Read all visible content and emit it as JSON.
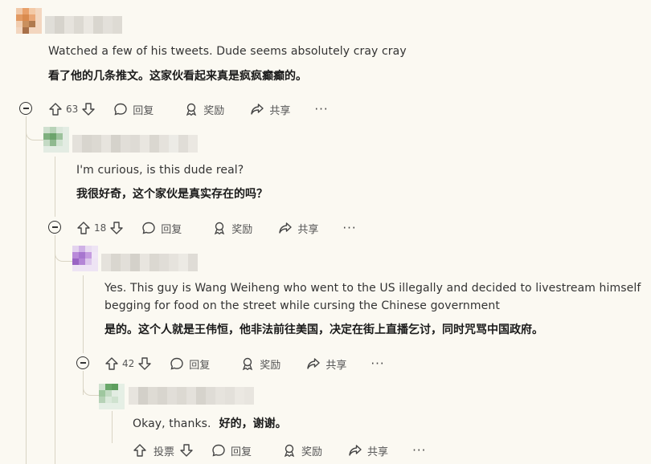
{
  "comments": [
    {
      "text_en": "Watched a few of his tweets. Dude seems absolutely cray cray",
      "text_zh": "看了他的几条推文。这家伙看起来真是疯疯癫癫的。",
      "score": "63",
      "reply_label": "回复",
      "award_label": "奖励",
      "share_label": "共享",
      "more_label": "···"
    },
    {
      "text_en": "I'm curious, is this dude real?",
      "text_zh": "我很好奇，这个家伙是真实存在的吗？",
      "score": "18",
      "reply_label": "回复",
      "award_label": "奖励",
      "share_label": "共享",
      "more_label": "···"
    },
    {
      "text_en_line1": "Yes. This guy is Wang Weiheng who went to the US illegally and decided to livestream himself",
      "text_en_line2": "begging for food on the street while cursing the Chinese government",
      "text_zh": "是的。这个人就是王伟恒，他非法前往美国，决定在街上直播乞讨，同时咒骂中国政府。",
      "score": "42",
      "reply_label": "回复",
      "award_label": "奖励",
      "share_label": "共享",
      "more_label": "···"
    },
    {
      "text_en": "Okay, thanks.",
      "text_zh": "好的，谢谢。",
      "vote_label": "投票",
      "reply_label": "回复",
      "award_label": "奖励",
      "share_label": "共享",
      "more_label": "···"
    }
  ],
  "colors": {
    "background": "#fbf9f2",
    "thread_line": "#d9d4c4",
    "avatar1": "#e8a06a",
    "avatar2": "#7fb07f",
    "avatar3": "#b98ad9",
    "avatar4": "#6aa86a"
  }
}
